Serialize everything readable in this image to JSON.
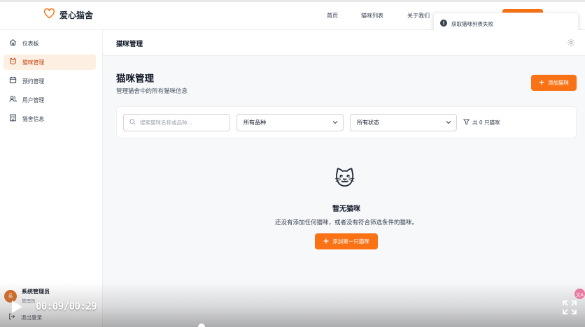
{
  "brand": {
    "name": "爱心猫舍",
    "accent": "#f97316"
  },
  "nav": {
    "items": [
      {
        "label": "首页"
      },
      {
        "label": "猫咪列表"
      },
      {
        "label": "关于我们"
      }
    ]
  },
  "toast": {
    "message": "获取猫咪列表失败",
    "icon": "error-icon"
  },
  "sidebar": {
    "items": [
      {
        "label": "仪表板",
        "icon": "home-icon"
      },
      {
        "label": "猫咪管理",
        "icon": "cat-icon",
        "active": true
      },
      {
        "label": "预约管理",
        "icon": "calendar-icon"
      },
      {
        "label": "用户管理",
        "icon": "users-icon"
      },
      {
        "label": "猫舍信息",
        "icon": "building-icon"
      }
    ],
    "user": {
      "avatar": "系",
      "name": "系统管理员",
      "role": "管理员"
    },
    "logout": "退出登录"
  },
  "header": {
    "title": "猫咪管理"
  },
  "page": {
    "title": "猫咪管理",
    "subtitle": "管理猫舍中的所有猫咪信息",
    "add_label": "添加猫咪"
  },
  "filters": {
    "search_placeholder": "搜索猫咪名称或品种...",
    "breed_selected": "所有品种",
    "status_selected": "所有状态",
    "count_text": "共 0 只猫咪"
  },
  "empty": {
    "emoji": "🐱",
    "title": "暂无猫咪",
    "description": "还没有添加任何猫咪，或者没有符合筛选条件的猫咪。",
    "button": "添加第一只猫咪"
  },
  "video": {
    "time": "00:09/00:29",
    "lang": "文A"
  }
}
